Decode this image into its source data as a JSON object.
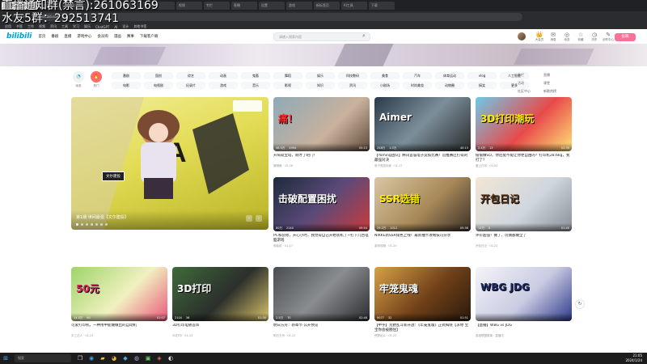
{
  "overlay": {
    "line1": "直播通知群(禁言):261063169",
    "line2": "水友5群：292513741"
  },
  "browser": {
    "tabs": [
      "哔哩哔哩 (゜-゜)つロ",
      "热搜",
      "百度一下",
      "B站创作",
      "更新",
      "Chat",
      "视频",
      "专栏",
      "直播",
      "设置",
      "游戏",
      "新标签页",
      "AI工具",
      "下载"
    ],
    "url": "bilibili.com",
    "bookmarks": [
      "应用",
      "书签",
      "工作",
      "视频",
      "资讯",
      "工具",
      "学习",
      "娱乐",
      "ChatGPT",
      "AI",
      "设计",
      "其他书签"
    ]
  },
  "nav": {
    "logo": "bilibili",
    "links": [
      "首页",
      "番剧",
      "直播",
      "游戏中心",
      "会员购",
      "漫画",
      "赛事",
      "下载客户端"
    ],
    "search_placeholder": "请输入搜索内容",
    "right": [
      {
        "icon": "👑",
        "label": "大会员"
      },
      {
        "icon": "✉",
        "label": "消息"
      },
      {
        "icon": "◎",
        "label": "动态"
      },
      {
        "icon": "☆",
        "label": "收藏"
      },
      {
        "icon": "◷",
        "label": "历史"
      },
      {
        "icon": "✎",
        "label": "创作中心"
      }
    ],
    "upload": "投稿"
  },
  "channels": {
    "dynamic": "动态",
    "hot": "热门",
    "row1": [
      "番剧",
      "国创",
      "综艺",
      "动画",
      "鬼畜",
      "舞蹈",
      "娱乐",
      "科技数码",
      "美食",
      "汽车",
      "体育运动",
      "vlog",
      "人工智能"
    ],
    "row2": [
      "电影",
      "电视剧",
      "纪录片",
      "游戏",
      "音乐",
      "影视",
      "知识",
      "资讯",
      "小剧场",
      "时尚美妆",
      "动物圈",
      "搞笑",
      "更多"
    ],
    "right": [
      "专栏",
      "直播",
      "活动",
      "课堂",
      "社区中心",
      "新歌热榜"
    ]
  },
  "hero": {
    "caption": "第1期 世间最强【文尔建投】",
    "tag": "文尔建投"
  },
  "cards": [
    {
      "title": "开局就宝塔，刚才了吧门！",
      "views": "46.5万",
      "danmaku": "2994",
      "duration": "05:13",
      "up": "哦哦哦",
      "date": "15-28",
      "label": "痛！"
    },
    {
      "title": "【Yoming团队】腾讯首届电子竞技比赛！首推赛区打得的最强对决",
      "views": "258万",
      "danmaku": "1.5万",
      "duration": "40:13",
      "up": "电子竞技玩家",
      "date": "01-17",
      "label": "Aimer"
    },
    {
      "title": "偷偷做SO，你还能不能让你更自由的？打印机28.6kg，我打了？",
      "views": "2.4万",
      "danmaku": "13",
      "duration": "02:30",
      "up": "爱上打印",
      "date": "02-00",
      "label": "3D打印潮玩"
    },
    {
      "title": "PC和装修，开心小时，我觉得自己开始装机了~打下几台电脑游戏",
      "views": "80万",
      "danmaku": "2140",
      "duration": "09:54",
      "up": "电脑说",
      "date": "01-17",
      "label": "击破配置困扰"
    },
    {
      "title": "NIKKE新SSR角色上线！最新抽卡攻略技巧分享",
      "views": "29.2万",
      "danmaku": "1012",
      "duration": "05:36",
      "up": "游戏攻略",
      "date": "01-20",
      "label": "SSR选错"
    },
    {
      "title": "评价超强！做了，玩偶都做全了",
      "views": "14万",
      "danmaku": "0",
      "duration": "01:40",
      "up": "开包日记",
      "date": "01-22",
      "label": "开包日记"
    },
    {
      "title": "可爱打印机，一种用中能做做出的自动机",
      "views": "14.5万",
      "danmaku": "90",
      "duration": "01:07",
      "up": "手工达人",
      "date": "01-22",
      "label": "50元"
    },
    {
      "title": "3D打印电镀首饰",
      "views": "2104",
      "danmaku": "36",
      "duration": "01:30",
      "up": "3D打印",
      "date": "01-22",
      "label": "3D打印"
    },
    {
      "title": "明日方舟：新章节 公开预览",
      "views": "2.5万",
      "danmaku": "70",
      "duration": "02:48",
      "up": "明日方舟",
      "date": "01-22",
      "label": ""
    },
    {
      "title": "【中字】荒野乱斗新开放：《牢笼鬼魂》正式揭晓【求你 宝宝你会被圈住】",
      "views": "9077",
      "danmaku": "32",
      "duration": "01:51",
      "up": "荒野乱斗",
      "date": "01-22",
      "label": "牢笼鬼魂"
    },
    {
      "title": "【直播】WBG vs JDG",
      "views": "",
      "danmaku": "",
      "duration": "",
      "up": "英雄联盟赛事",
      "date": "直播中",
      "label": "WBG JDG"
    }
  ],
  "taskbar": {
    "search": "搜索",
    "time": "21:05",
    "date": "2024/1/24"
  }
}
